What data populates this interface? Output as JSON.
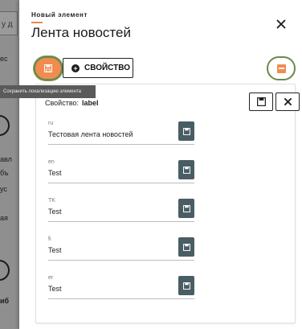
{
  "background": {
    "fragments": [
      "у  д",
      "ес",
      "авл",
      "бъ",
      "ус",
      "ая",
      "иб"
    ]
  },
  "panel": {
    "subtitle": "Новый элемент",
    "title": "Лента новостей",
    "property_button_label": "СВОЙСТВО",
    "tooltip": "Сохранить локализацию элемента",
    "property_label_prefix": "Свойство:",
    "property_name": "label",
    "fields": [
      {
        "lang": "ru",
        "value": "Тестовая лента новостей"
      },
      {
        "lang": "en",
        "value": "Test"
      },
      {
        "lang": "TK",
        "value": "Test"
      },
      {
        "lang": "fi",
        "value": "Test"
      },
      {
        "lang": "er",
        "value": "Test"
      }
    ]
  },
  "colors": {
    "accent": "#f08c50",
    "highlight_ring": "#6a8a4a",
    "field_button": "#4a5d64"
  },
  "icons": {
    "close": "close-icon",
    "save": "floppy-disk-icon",
    "plus": "plus-circle-icon",
    "localization": "localization-icon"
  }
}
